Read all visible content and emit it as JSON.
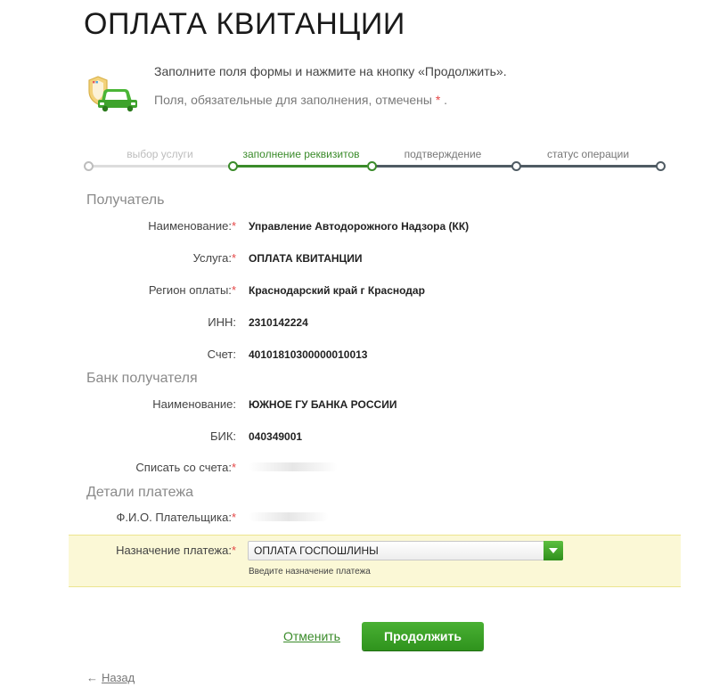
{
  "page": {
    "title": "ОПЛАТА КВИТАНЦИИ",
    "intro_line1": "Заполните поля формы и нажмите на кнопку «Продолжить».",
    "intro_line2_prefix": "Поля, обязательные для заполнения, отмечены",
    "required_mark": "*",
    "intro_line2_suffix": ".",
    "icon": "traffic-police-car-icon"
  },
  "steps": [
    {
      "label": "выбор услуги",
      "state": "done"
    },
    {
      "label": "заполнение реквизитов",
      "state": "active"
    },
    {
      "label": "подтверждение",
      "state": "pending"
    },
    {
      "label": "статус операции",
      "state": "pending"
    }
  ],
  "recipient": {
    "heading": "Получатель",
    "name_label": "Наименование:",
    "name_value": "Управление Автодорожного Надзора (КК)",
    "service_label": "Услуга:",
    "service_value": "ОПЛАТА КВИТАНЦИИ",
    "region_label": "Регион оплаты:",
    "region_value": "Краснодарский край г Краснодар",
    "inn_label": "ИНН:",
    "inn_value": "2310142224",
    "account_label": "Счет:",
    "account_value": "40101810300000010013"
  },
  "bank": {
    "heading": "Банк получателя",
    "name_label": "Наименование:",
    "name_value": "ЮЖНОЕ ГУ БАНКА РОССИИ",
    "bik_label": "БИК:",
    "bik_value": "040349001",
    "debit_label": "Списать со счета:"
  },
  "details": {
    "heading": "Детали платежа",
    "payer_label": "Ф.И.О. Плательщика:",
    "purpose_label": "Назначение платежа:",
    "purpose_value": "ОПЛАТА ГОСПОШЛИНЫ",
    "purpose_hint": "Введите назначение платежа"
  },
  "actions": {
    "cancel": "Отменить",
    "continue": "Продолжить",
    "back_arrow": "←",
    "back": "Назад"
  },
  "colors": {
    "accent_green": "#3a8b2a",
    "required_red": "#e54646",
    "highlight_bg": "#fbf8d6"
  }
}
